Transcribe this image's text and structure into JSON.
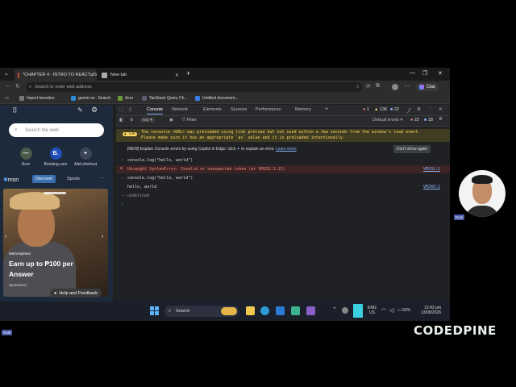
{
  "browser": {
    "tabs": [
      {
        "title": "*CHAPTER 4 - INTRO TO REACT JS",
        "active": true
      },
      {
        "title": "New tab",
        "active": false
      }
    ],
    "address_placeholder": "Search or enter web address",
    "chat_label": "Chat",
    "favorites": [
      "Import favorites",
      "gemini ai - Search",
      "Acer",
      "TanStack Query Ch...",
      "Untitled document..."
    ]
  },
  "new_tab": {
    "search_placeholder": "Search the web",
    "shortcuts": [
      "Acer",
      "Booking.com",
      "Add shortcut"
    ],
    "msn_label": "msn",
    "msn_tabs": [
      "Discover",
      "Sports"
    ],
    "more_label": "···",
    "hero": {
      "source": "MetroOpinion",
      "headline_line1": "Earn up to ₱100 per",
      "headline_line2": "Answer",
      "sponsored": "Sponsored"
    },
    "help_label": "Help and Feedback"
  },
  "devtools": {
    "tabs": [
      "Console",
      "Network",
      "Elements",
      "Sources",
      "Performance",
      "Memory"
    ],
    "active_tab": "Console",
    "counts": {
      "errors": "1",
      "warnings": "136",
      "info": "22"
    },
    "filter_label": "Filter",
    "context": "top",
    "default_levels": "Default levels",
    "toolbar_counts": {
      "warnings": "22",
      "info": "18"
    },
    "warning_badge": "13k",
    "warning_line1": "The resource <URL> was preloaded using link preload but not used within a few seconds from the window's load event.",
    "warning_line2": "Please make sure it has an appropriate `as` value and it is preloaded intentionally.",
    "copilot_text": "[NEW] Explain Console errors by using Copilot in Edge: click",
    "copilot_text2": "to explain an error.",
    "learn_more": "Learn more",
    "dont_show": "Don't show again",
    "lines": [
      {
        "text": "console.log(\"hello, world\")",
        "type": "input"
      },
      {
        "text": "Uncaught SyntaxError: Invalid or unexpected token (at VM332:1:13)",
        "type": "error",
        "source": "VM332:1"
      },
      {
        "text": "console.log(\"hello, world\")",
        "type": "input"
      },
      {
        "text": "hello, world",
        "type": "output",
        "source": "VM340:1"
      },
      {
        "text": "undefined",
        "type": "return"
      }
    ]
  },
  "taskbar": {
    "search_label": "Search",
    "lang_line1": "ENG",
    "lang_line2": "US",
    "battery": "52%",
    "time": "12:43 pm",
    "date": "13/09/2026"
  },
  "overlay": {
    "name_tag": "Noel",
    "logo_part1": "C",
    "logo_part2": "D",
    "logo_full": "CODEDPINE"
  },
  "colors": {
    "accent": "#8ab4f8",
    "error": "#f28b82",
    "warning": "#fdd663",
    "logo_green": "#7bd67c"
  }
}
